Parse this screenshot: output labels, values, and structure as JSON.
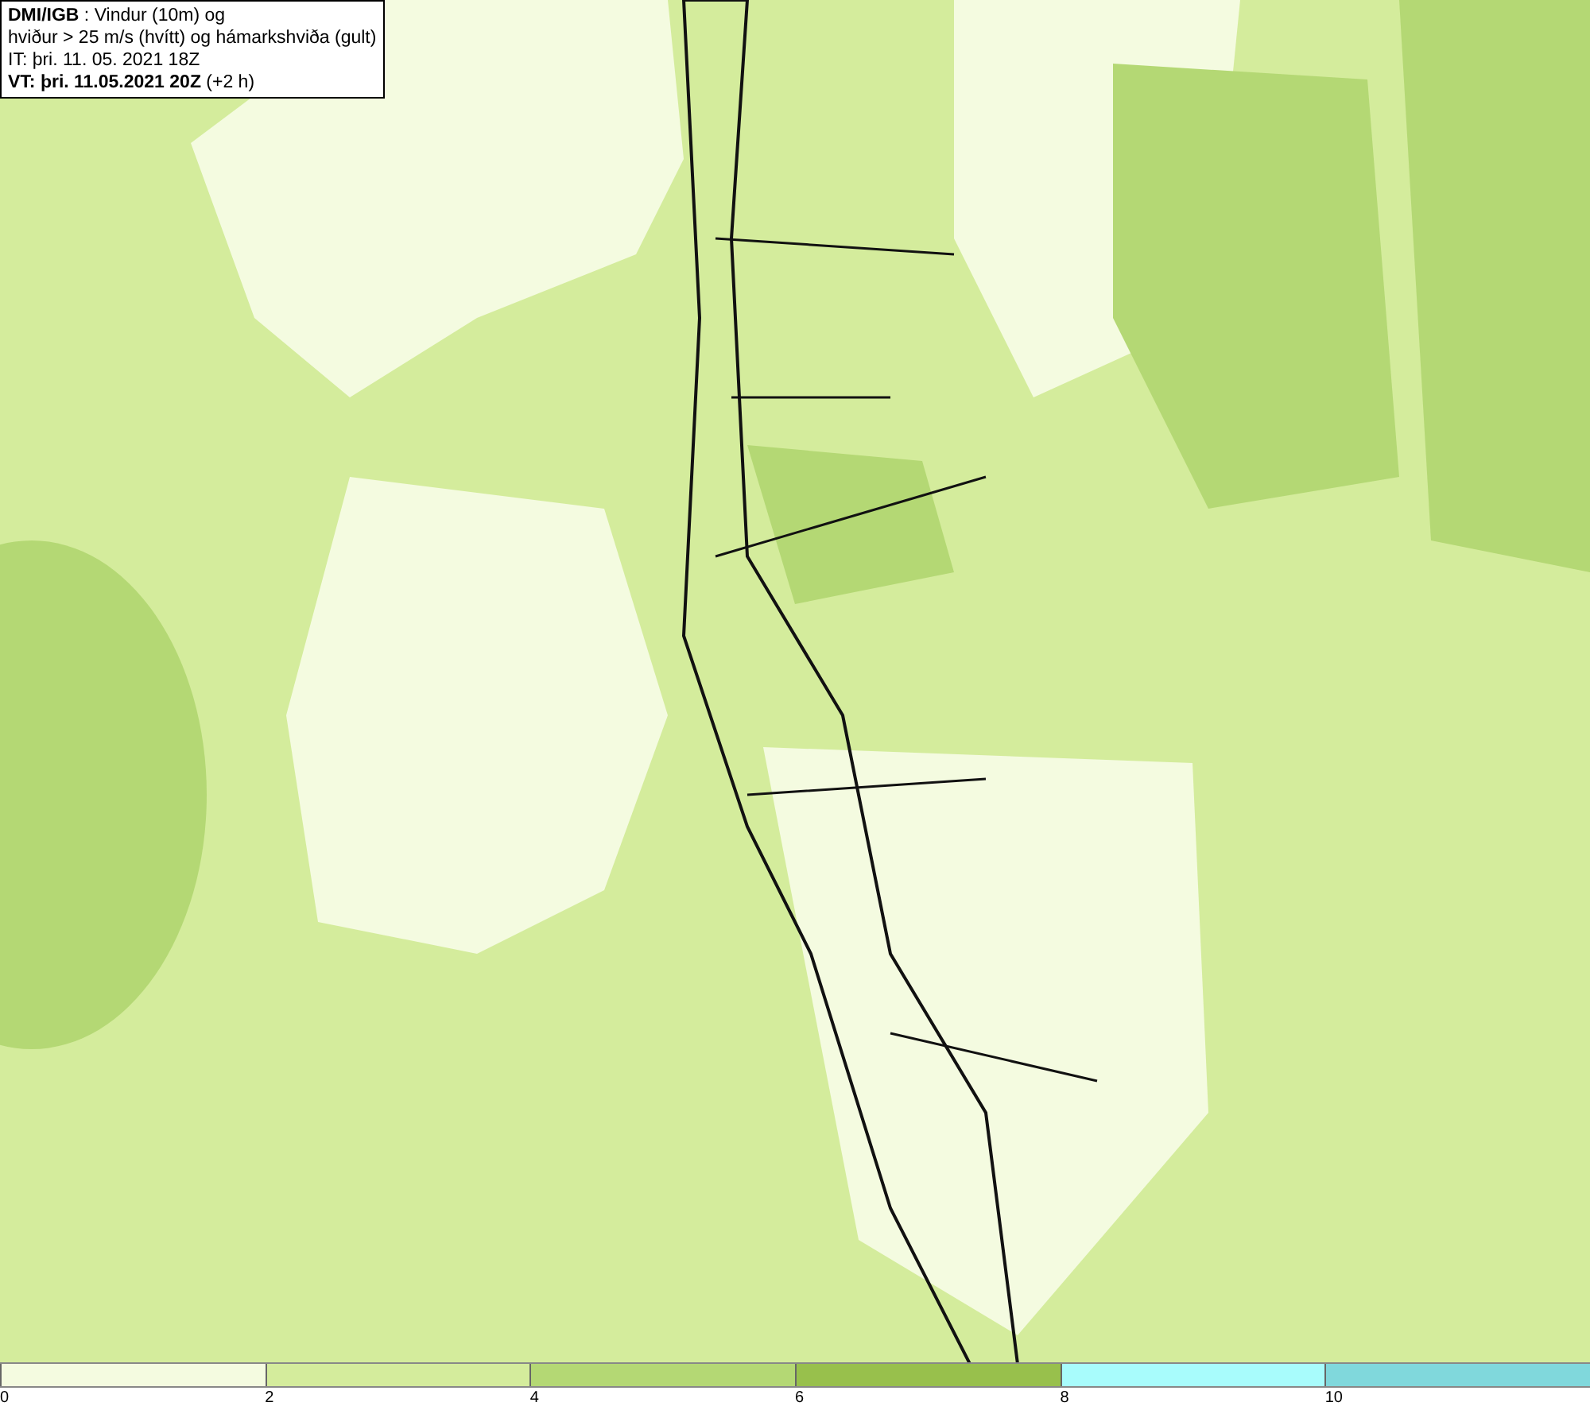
{
  "info_box": {
    "lines": [
      "**DMI/IGB** : Vindur (10m) og",
      "hviður > 25 m/s (hvítt) og hámarkshviða (gult)",
      "IT: þri. 11. 05. 2021 18Z",
      "**VT: þri. 11.05.2021 20Z** (+2 h)"
    ]
  },
  "color_scale": {
    "segments": [
      {
        "color": "#f4fbe0"
      },
      {
        "color": "#d4ec9c"
      },
      {
        "color": "#b4d874"
      },
      {
        "color": "#98c04c"
      },
      {
        "color": "#a8fcfc"
      },
      {
        "color": "#80d8dc"
      }
    ],
    "labels": [
      "0",
      "2",
      "4",
      "6",
      "8",
      "10"
    ]
  }
}
